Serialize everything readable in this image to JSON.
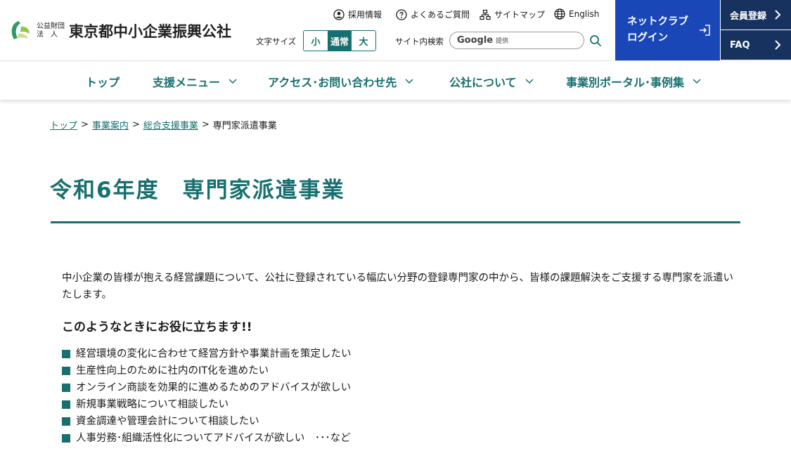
{
  "header": {
    "logo_small_top": "公益財団",
    "logo_small_bottom": "法　人",
    "logo_main": "東京都中小企業振興公社",
    "util_links": [
      {
        "label": "採用情報",
        "icon": "person-circle-icon"
      },
      {
        "label": "よくあるご質問",
        "icon": "question-circle-icon"
      },
      {
        "label": "サイトマップ",
        "icon": "sitemap-icon"
      },
      {
        "label": "English",
        "icon": "globe-icon"
      }
    ],
    "font_size_label": "文字サイズ",
    "font_sizes": [
      "小",
      "通常",
      "大"
    ],
    "font_size_selected": "通常",
    "search_label": "サイト内検索",
    "search_google": "Google",
    "search_provided": "提供",
    "netclub_line1": "ネットクラブ",
    "netclub_line2": "ログイン",
    "member_label": "会員登録",
    "faq_label": "FAQ"
  },
  "nav": {
    "items": [
      {
        "label": "トップ",
        "has_dropdown": false
      },
      {
        "label": "支援メニュー",
        "has_dropdown": true
      },
      {
        "label": "アクセス･お問い合わせ先",
        "has_dropdown": true
      },
      {
        "label": "公社について",
        "has_dropdown": true
      },
      {
        "label": "事業別ポータル･事例集",
        "has_dropdown": true
      }
    ]
  },
  "breadcrumb": {
    "items": [
      "トップ",
      "事業案内",
      "総合支援事業"
    ],
    "current": "専門家派遣事業",
    "separator": ">"
  },
  "main": {
    "title": "令和6年度　専門家派遣事業",
    "intro": "中小企業の皆様が抱える経営課題について、公社に登録されている幅広い分野の登録専門家の中から、皆様の課題解決をご支援する専門家を派遣いたします。",
    "subheading": "このようなときにお役に立ちます!!",
    "bullets": [
      "経営環境の変化に合わせて経営方針や事業計画を策定したい",
      "生産性向上のために社内のIT化を進めたい",
      "オンライン商談を効果的に進めるためのアドバイスが欲しい",
      "新規事業戦略について相談したい",
      "資金調達や管理会計について相談したい",
      "人事労務･組織活性化についてアドバイスが欲しい　･･･など"
    ]
  },
  "colors": {
    "accent": "#17706f",
    "netclub": "#1a47b8",
    "side_nav": "#17325f"
  }
}
